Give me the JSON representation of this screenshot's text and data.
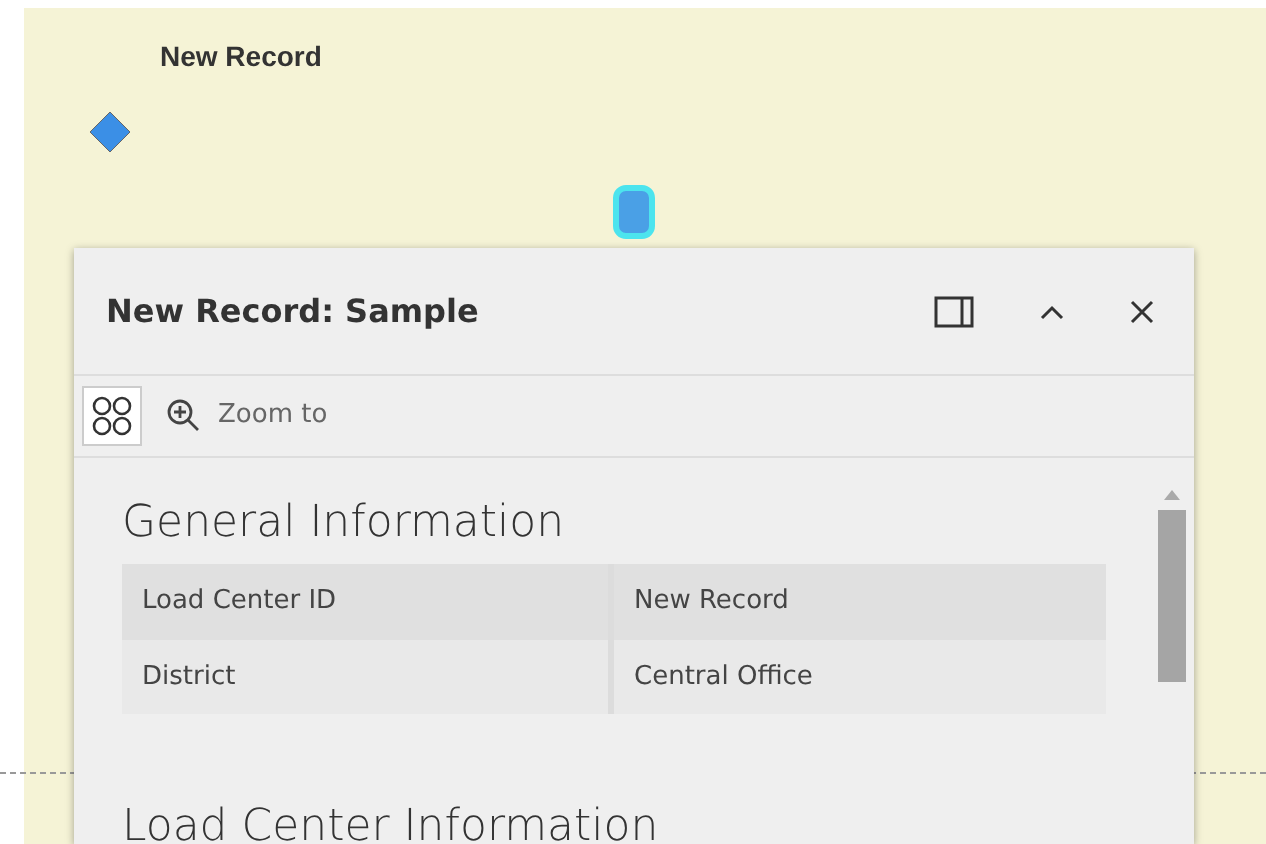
{
  "map": {
    "label": "New Record"
  },
  "popup": {
    "title": "New Record: Sample",
    "toolbar": {
      "zoom_label": "Zoom to"
    },
    "sections": [
      {
        "heading": "General Information",
        "rows": [
          {
            "field": "Load Center ID",
            "value": "New Record"
          },
          {
            "field": "District",
            "value": "Central Office"
          }
        ]
      },
      {
        "heading": "Load Center Information"
      }
    ]
  }
}
